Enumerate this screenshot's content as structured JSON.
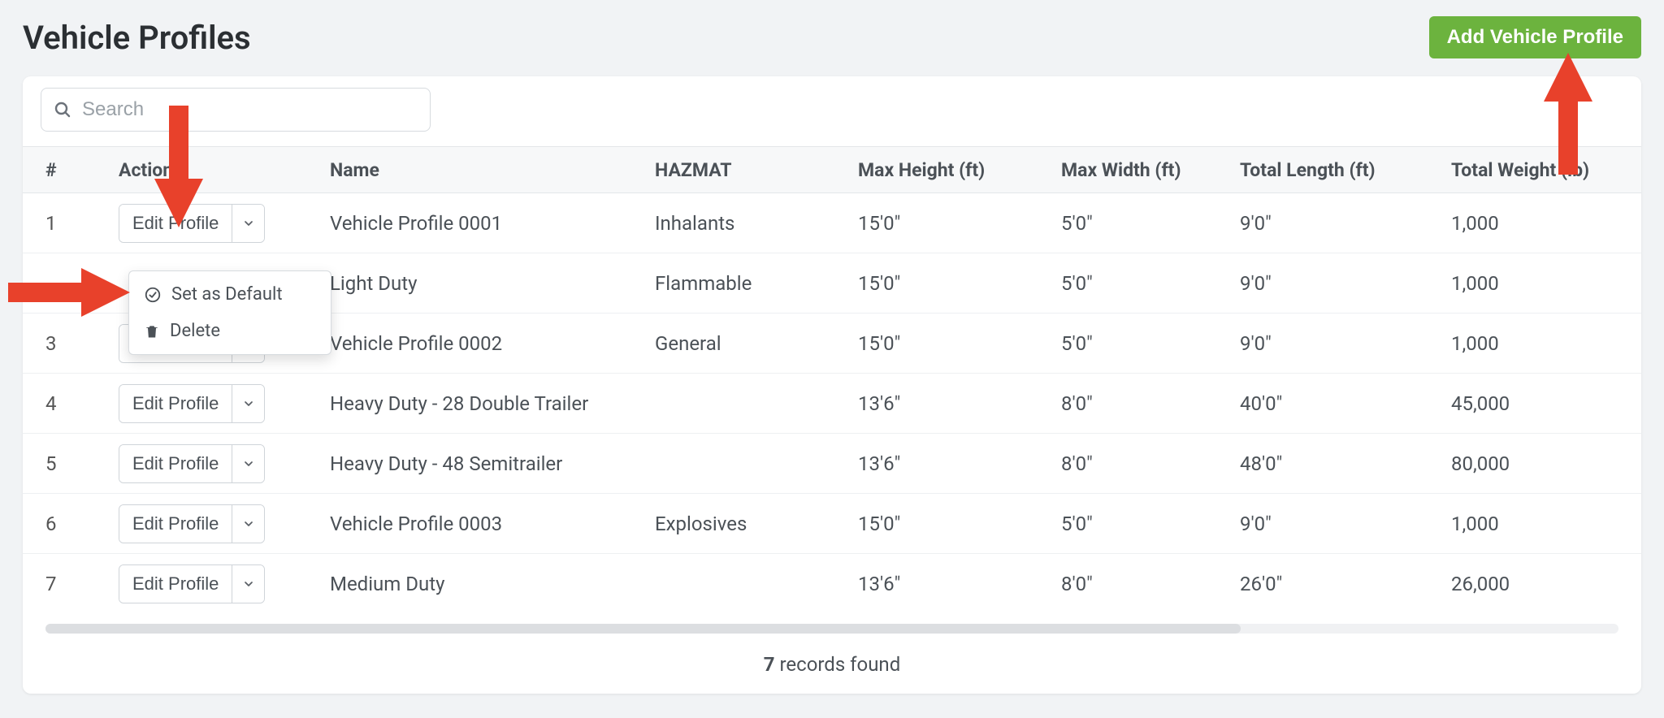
{
  "page": {
    "title": "Vehicle Profiles",
    "add_button": "Add Vehicle Profile",
    "search_placeholder": "Search",
    "records_count": "7",
    "records_suffix": " records found"
  },
  "columns": {
    "idx": "#",
    "actions": "Actions",
    "name": "Name",
    "hazmat": "HAZMAT",
    "max_height": "Max Height (ft)",
    "max_width": "Max Width (ft)",
    "total_length": "Total Length (ft)",
    "total_weight": "Total Weight (lb)"
  },
  "actions": {
    "edit_profile": "Edit Profile",
    "set_default": "Set as Default",
    "delete": "Delete"
  },
  "rows": [
    {
      "idx": "1",
      "name": "Vehicle Profile 0001",
      "hazmat": "Inhalants",
      "max_height": "15'0\"",
      "max_width": "5'0\"",
      "total_length": "9'0\"",
      "total_weight": "1,000"
    },
    {
      "idx": "",
      "name": "Light Duty",
      "hazmat": "Flammable",
      "max_height": "15'0\"",
      "max_width": "5'0\"",
      "total_length": "9'0\"",
      "total_weight": "1,000"
    },
    {
      "idx": "3",
      "name": "Vehicle Profile 0002",
      "hazmat": "General",
      "max_height": "15'0\"",
      "max_width": "5'0\"",
      "total_length": "9'0\"",
      "total_weight": "1,000"
    },
    {
      "idx": "4",
      "name": "Heavy Duty - 28 Double Trailer",
      "hazmat": "",
      "max_height": "13'6\"",
      "max_width": "8'0\"",
      "total_length": "40'0\"",
      "total_weight": "45,000"
    },
    {
      "idx": "5",
      "name": "Heavy Duty - 48 Semitrailer",
      "hazmat": "",
      "max_height": "13'6\"",
      "max_width": "8'0\"",
      "total_length": "48'0\"",
      "total_weight": "80,000"
    },
    {
      "idx": "6",
      "name": "Vehicle Profile 0003",
      "hazmat": "Explosives",
      "max_height": "15'0\"",
      "max_width": "5'0\"",
      "total_length": "9'0\"",
      "total_weight": "1,000"
    },
    {
      "idx": "7",
      "name": "Medium Duty",
      "hazmat": "",
      "max_height": "13'6\"",
      "max_width": "8'0\"",
      "total_length": "26'0\"",
      "total_weight": "26,000"
    }
  ]
}
